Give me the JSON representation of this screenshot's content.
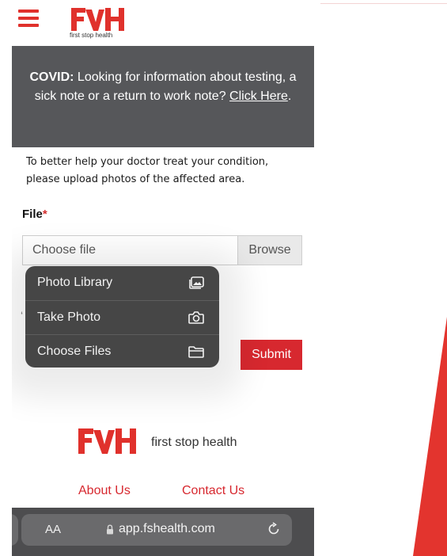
{
  "header": {
    "menu_icon": "hamburger-menu-icon",
    "logo_tagline": "first stop health"
  },
  "covid_banner": {
    "bold": "COVID:",
    "text": " Looking for information about testing, a sick note or a return to work note? ",
    "link": "Click Here",
    "after": "."
  },
  "form": {
    "intro": "To better help your doctor treat your condition, please upload photos of the affected area.",
    "file_label": "File",
    "required_mark": "*",
    "file_placeholder": "Choose file",
    "browse_label": "Browse",
    "submit_label": "Submit",
    "stray_char": "‘"
  },
  "popup_menu": {
    "items": [
      {
        "label": "Photo Library",
        "icon": "photo-library-icon"
      },
      {
        "label": "Take Photo",
        "icon": "camera-icon"
      },
      {
        "label": "Choose Files",
        "icon": "folder-icon"
      }
    ]
  },
  "footer": {
    "brand_name": "first stop health",
    "links": [
      "About Us",
      "Contact Us"
    ]
  },
  "browser": {
    "aa_label": "AA",
    "url": "app.fshealth.com",
    "reload_icon": "reload-icon"
  },
  "colors": {
    "brand_red": "#e0312c",
    "banner_gray": "#56575a",
    "submit_red": "#d7282f"
  }
}
